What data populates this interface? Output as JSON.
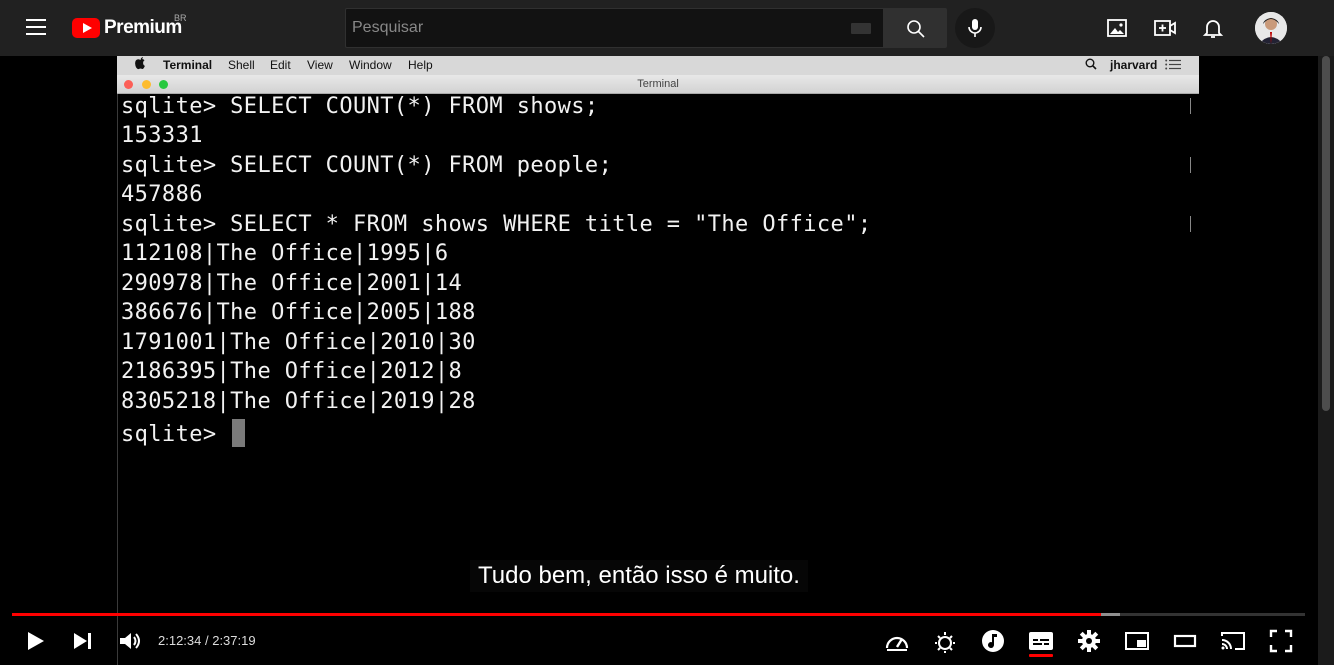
{
  "youtube": {
    "logo_text": "Premium",
    "country": "BR",
    "search_placeholder": "Pesquisar",
    "colors": {
      "brand": "#ff0000",
      "topbar": "#212121"
    }
  },
  "mac": {
    "apple": "",
    "menu": [
      "Terminal",
      "Shell",
      "Edit",
      "View",
      "Window",
      "Help"
    ],
    "user": "jharvard",
    "window_title": "Terminal"
  },
  "terminal": {
    "lines": [
      "sqlite> SELECT COUNT(*) FROM shows;",
      "153331",
      "sqlite> SELECT COUNT(*) FROM people;",
      "457886",
      "sqlite> SELECT * FROM shows WHERE title = \"The Office\";",
      "112108|The Office|1995|6",
      "290978|The Office|2001|14",
      "386676|The Office|2005|188",
      "1791001|The Office|2010|30",
      "2186395|The Office|2012|8",
      "8305218|The Office|2019|28"
    ],
    "prompt": "sqlite> "
  },
  "subtitle": "Tudo bem, então isso é muito.",
  "player": {
    "current_time": "2:12:34",
    "duration": "2:37:19",
    "time_display": "2:12:34 / 2:37:19",
    "played_fraction": 0.842,
    "loaded_fraction": 0.857
  }
}
